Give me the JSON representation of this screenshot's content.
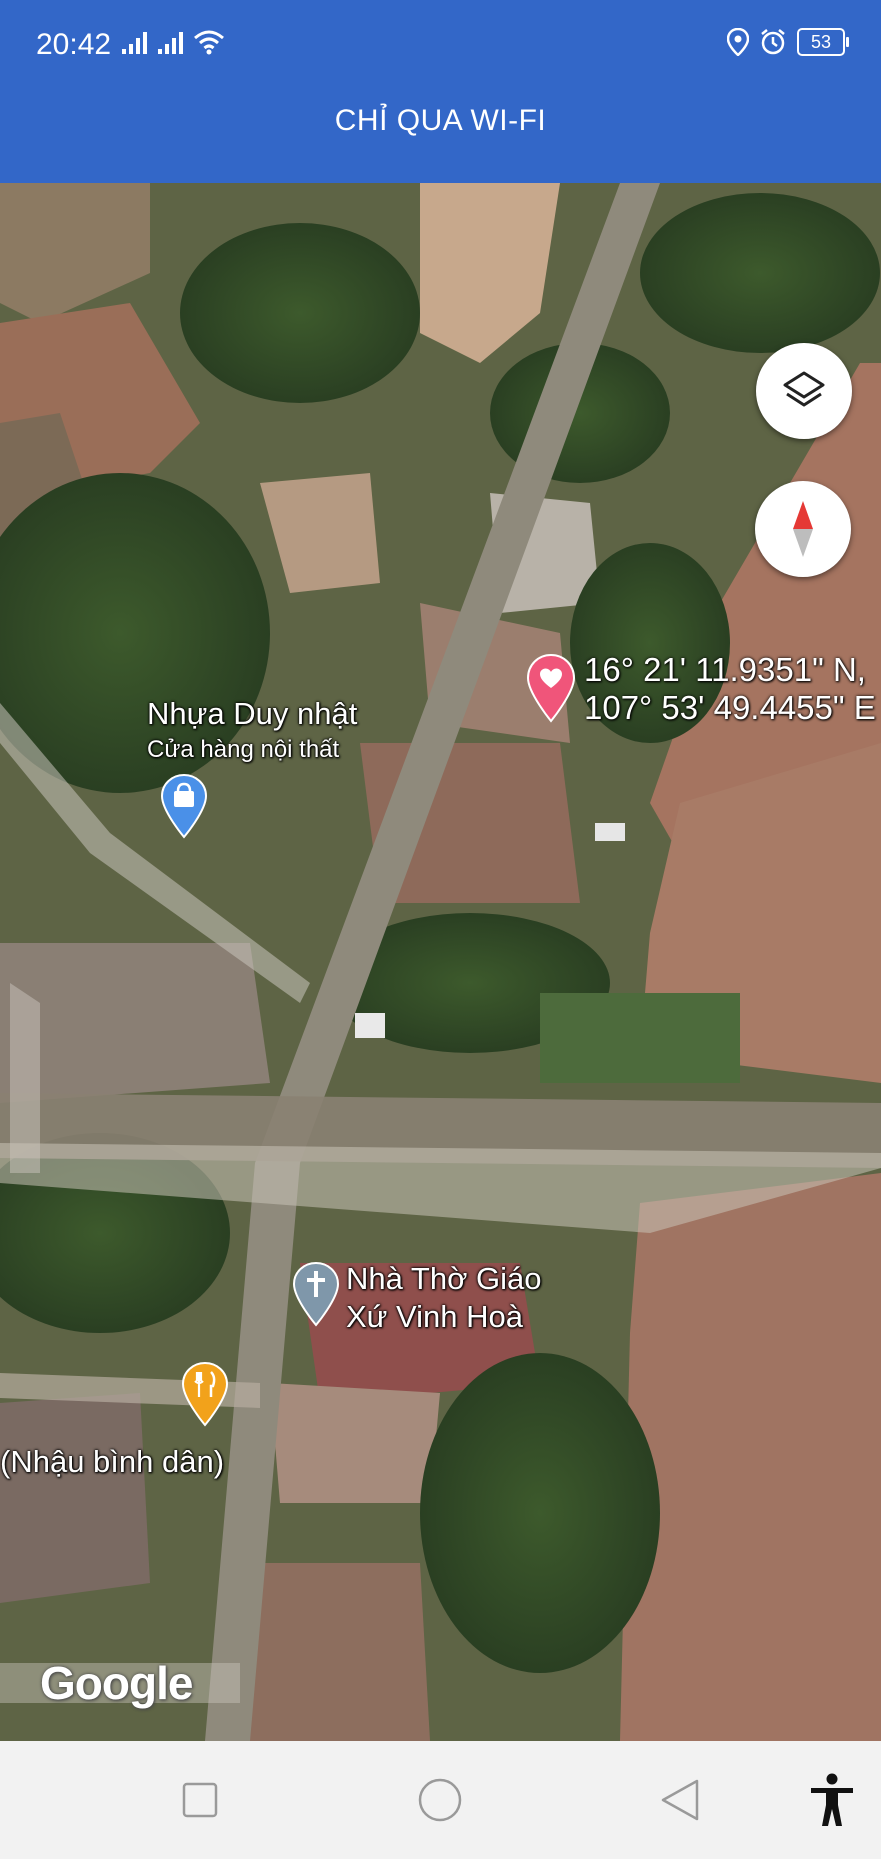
{
  "status_bar": {
    "time": "20:42",
    "battery": "53",
    "icons": [
      "signal-icon",
      "signal-icon",
      "wifi-icon",
      "location-icon",
      "alarm-icon",
      "battery-icon"
    ]
  },
  "header": {
    "title": "CHỈ QUA WI-FI",
    "background_color": "#3367c8"
  },
  "map": {
    "marker_coordinates": {
      "lat": "16° 21' 11.9351\" N,",
      "lon": "107° 53' 49.4455\" E"
    },
    "places": [
      {
        "name": "Nhựa Duy nhật",
        "category": "Cửa hàng nội thất",
        "icon": "shopping-bag-pin-icon",
        "pin_color": "#4a90e8"
      },
      {
        "name_line1": "Nhà Thờ Giáo",
        "name_line2": "Xứ Vinh Hoà",
        "icon": "church-cross-pin-icon",
        "pin_color": "#7f97aa"
      },
      {
        "name": "(Nhậu bình dân)",
        "icon": "restaurant-pin-icon",
        "pin_color": "#f2a21b"
      }
    ],
    "marker_icon": "heart-pin-icon",
    "marker_color": "#f0557a",
    "controls": {
      "layers_icon": "layers-icon",
      "compass_icon": "compass-icon"
    },
    "attribution": "Google"
  },
  "nav_bar": {
    "buttons": [
      "recents-square-icon",
      "home-circle-icon",
      "back-triangle-icon",
      "accessibility-icon"
    ]
  }
}
